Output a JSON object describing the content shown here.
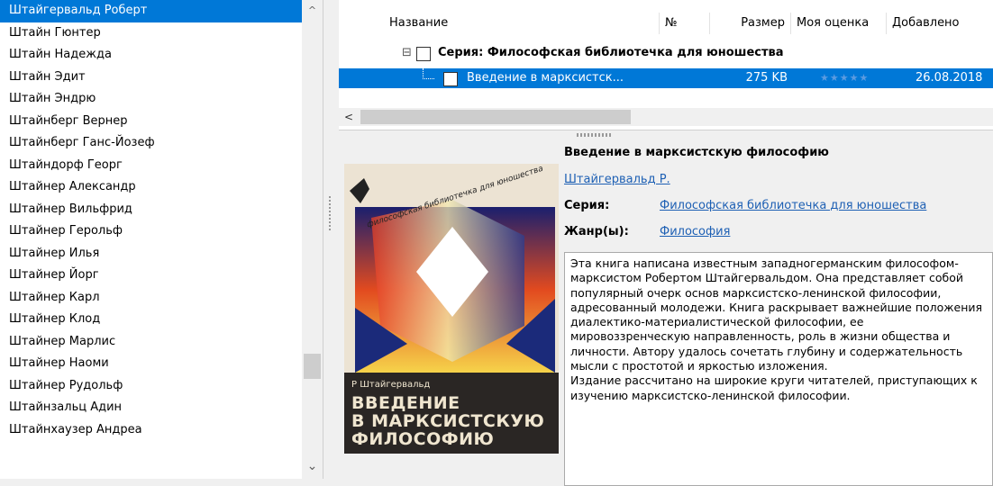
{
  "authors": {
    "items": [
      "Штайгервальд Роберт",
      "Штайн Гюнтер",
      "Штайн Надежда",
      "Штайн Эдит",
      "Штайн Эндрю",
      "Штайнберг Вернер",
      "Штайнберг Ганс-Йозеф",
      "Штайндорф Георг",
      "Штайнер Александр",
      "Штайнер Вильфрид",
      "Штайнер Герольф",
      "Штайнер Илья",
      "Штайнер Йорг",
      "Штайнер Карл",
      "Штайнер Клод",
      "Штайнер Марлис",
      "Штайнер Наоми",
      "Штайнер Рудольф",
      "Штайнзальц Адин",
      "Штайнхаузер Андреа"
    ],
    "selected_index": 0,
    "scroll_up_glyph": "^",
    "scroll_down_glyph": "⌄"
  },
  "table": {
    "columns": [
      "Название",
      "№",
      "Размер",
      "Моя оценка",
      "Добавлено"
    ],
    "series_label": "Серия: Философская библиотечка для юношества",
    "expander_glyph": "⊟",
    "book": {
      "title": "Введение в марксистск...",
      "size": "275 KB",
      "rating_stars": "★★★★★",
      "added": "26.08.2018"
    },
    "scroll_left_glyph": "<"
  },
  "details": {
    "title": "Введение в марксистскую философию",
    "author_link": "Штайгервальд Р.",
    "series_label": "Серия:",
    "series_value": "Философская библиотечка для юношества",
    "genre_label": "Жанр(ы):",
    "genre_value": "Философия",
    "description": "Эта книга написана известным западногерманским философом-марксистом Робертом Штайгервальдом. Она представляет собой популярный очерк основ марксистско-ленинской философии, адресованный молодежи. Книга раскрывает важнейшие положения диалектико-материалистической философии, ее мировоззренческую направленность, роль в жизни общества и личности. Автору удалось сочетать глубину и содержательность мысли с простотой и яркостью изложения.\nИздание рассчитано на широкие круги читателей, приступающих к изучению марксистско-ленинской философии."
  },
  "cover": {
    "series_text": "философская библиотечка для юношества",
    "author_text": "Р Штайгервальд",
    "title_lines": [
      "ВВЕДЕНИЕ",
      "В МАРКСИСТСКУЮ",
      "ФИЛОСОФИЮ"
    ]
  },
  "colors": {
    "selection": "#0078d7",
    "link": "#1e60b4"
  }
}
